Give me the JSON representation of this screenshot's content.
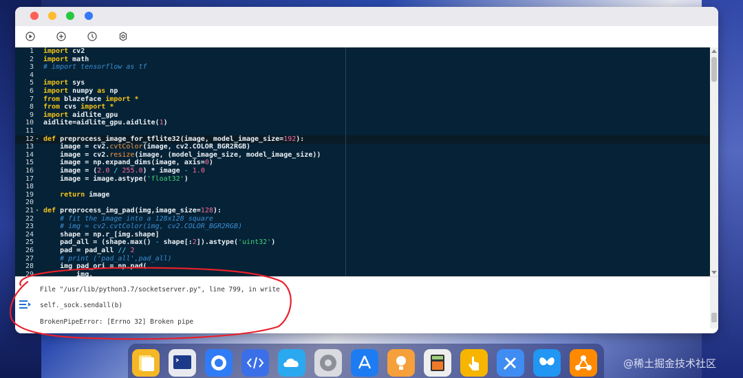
{
  "toolbar": {
    "buttons": [
      {
        "name": "run-button",
        "icon": "play-icon"
      },
      {
        "name": "add-button",
        "icon": "plus-icon"
      },
      {
        "name": "history-button",
        "icon": "clock-icon"
      },
      {
        "name": "settings-button",
        "icon": "gear-icon"
      }
    ]
  },
  "editor": {
    "lines": [
      {
        "n": "1",
        "fold": "",
        "segs": [
          [
            "k",
            "import"
          ],
          [
            "",
            "cv2"
          ]
        ]
      },
      {
        "n": "2",
        "fold": "",
        "segs": [
          [
            "k",
            "import"
          ],
          [
            "",
            "math"
          ]
        ]
      },
      {
        "n": "3",
        "fold": "",
        "segs": [
          [
            "c",
            "# import tensorflow as tf"
          ]
        ]
      },
      {
        "n": "4",
        "fold": "",
        "segs": []
      },
      {
        "n": "5",
        "fold": "",
        "segs": [
          [
            "k",
            "import"
          ],
          [
            "",
            "sys"
          ]
        ]
      },
      {
        "n": "6",
        "fold": "",
        "segs": [
          [
            "k",
            "import"
          ],
          [
            "",
            "numpy "
          ],
          [
            "k",
            "as"
          ],
          [
            "",
            "np"
          ]
        ]
      },
      {
        "n": "7",
        "fold": "",
        "segs": [
          [
            "k",
            "from"
          ],
          [
            "",
            "blazeface "
          ],
          [
            "k",
            "import"
          ],
          [
            "",
            ""
          ],
          [
            "k",
            "*"
          ]
        ]
      },
      {
        "n": "8",
        "fold": "",
        "segs": [
          [
            "k",
            "from"
          ],
          [
            "",
            "cvs "
          ],
          [
            "k",
            "import"
          ],
          [
            "",
            ""
          ],
          [
            "k",
            "*"
          ]
        ]
      },
      {
        "n": "9",
        "fold": "",
        "segs": [
          [
            "k",
            "import"
          ],
          [
            "",
            "aidlite_gpu"
          ]
        ]
      },
      {
        "n": "10",
        "fold": "",
        "segs": [
          [
            "",
            "aidlite=aidlite_gpu.aidlite("
          ],
          [
            "n",
            "1"
          ],
          [
            "",
            ")"
          ]
        ]
      },
      {
        "n": "11",
        "fold": "",
        "segs": []
      },
      {
        "n": "12",
        "fold": "▾",
        "segs": [
          [
            "k",
            "def"
          ],
          [
            "",
            "preprocess_image_for_tflite32(image, model_image_size="
          ],
          [
            "n",
            "192"
          ],
          [
            "",
            "):"
          ]
        ]
      },
      {
        "n": "13",
        "fold": "",
        "segs": [
          [
            "",
            "    image = cv2."
          ],
          [
            "f",
            "cvtColor"
          ],
          [
            "",
            "(image, cv2.COLOR_BGR2RGB)"
          ]
        ]
      },
      {
        "n": "14",
        "fold": "",
        "segs": [
          [
            "",
            "    image = cv2."
          ],
          [
            "f",
            "resize"
          ],
          [
            "",
            "(image, (model_image_size, model_image_size))"
          ]
        ]
      },
      {
        "n": "15",
        "fold": "",
        "segs": [
          [
            "",
            "    image = np.expand_dims(image, axis="
          ],
          [
            "n",
            "0"
          ],
          [
            "",
            ")"
          ]
        ]
      },
      {
        "n": "16",
        "fold": "",
        "segs": [
          [
            "",
            "    image = ("
          ],
          [
            "n",
            "2.0"
          ],
          [
            "b",
            " / "
          ],
          [
            "n",
            "255.0"
          ],
          [
            "",
            ") * image "
          ],
          [
            "b",
            "- "
          ],
          [
            "n",
            "1.0"
          ]
        ]
      },
      {
        "n": "17",
        "fold": "",
        "segs": [
          [
            "",
            "    image = image.astype("
          ],
          [
            "s",
            "'float32'"
          ],
          [
            "",
            ")"
          ]
        ]
      },
      {
        "n": "18",
        "fold": "",
        "segs": []
      },
      {
        "n": "19",
        "fold": "",
        "segs": [
          [
            "",
            "    "
          ],
          [
            "k",
            "return"
          ],
          [
            "",
            "image"
          ]
        ]
      },
      {
        "n": "20",
        "fold": "",
        "segs": []
      },
      {
        "n": "21",
        "fold": "▾",
        "segs": [
          [
            "k",
            "def"
          ],
          [
            "",
            "preprocess_img_pad(img,image_size="
          ],
          [
            "n",
            "128"
          ],
          [
            "",
            "):"
          ]
        ]
      },
      {
        "n": "22",
        "fold": "",
        "segs": [
          [
            "",
            "    "
          ],
          [
            "c",
            "# fit the image into a 128x128 square"
          ]
        ]
      },
      {
        "n": "23",
        "fold": "",
        "segs": [
          [
            "",
            "    "
          ],
          [
            "c",
            "# img = cv2.cvtColor(img, cv2.COLOR_BGR2RGB)"
          ]
        ]
      },
      {
        "n": "24",
        "fold": "",
        "segs": [
          [
            "",
            "    shape = np.r_[img.shape]"
          ]
        ]
      },
      {
        "n": "25",
        "fold": "",
        "segs": [
          [
            "",
            "    pad_all = (shape.max() "
          ],
          [
            "b",
            "- "
          ],
          [
            "",
            "shape[:"
          ],
          [
            "n",
            "2"
          ],
          [
            "",
            "]).astype("
          ],
          [
            "s",
            "'uint32'"
          ],
          [
            "",
            ")"
          ]
        ]
      },
      {
        "n": "26",
        "fold": "",
        "segs": [
          [
            "",
            "    pad = pad_all "
          ],
          [
            "b",
            "// "
          ],
          [
            "n",
            "2"
          ]
        ]
      },
      {
        "n": "27",
        "fold": "",
        "segs": [
          [
            "",
            "    "
          ],
          [
            "c",
            "# print ('pad_all',pad_all)"
          ]
        ]
      },
      {
        "n": "28",
        "fold": "",
        "segs": [
          [
            "",
            "    img_pad_ori = np.pad("
          ]
        ]
      },
      {
        "n": "29",
        "fold": "",
        "segs": [
          [
            "",
            "        img,"
          ]
        ]
      }
    ]
  },
  "console": {
    "line1": "File \"/usr/lib/python3.7/socketserver.py\", line 799, in write",
    "line2": "self._sock.sendall(b)",
    "line3": "BrokenPipeError: [Errno 32] Broken pipe"
  },
  "dock": {
    "apps": [
      "files-app-icon",
      "terminal-app-icon",
      "browser-app-icon",
      "code-app-icon",
      "cloud-app-icon",
      "settings-app-icon",
      "app-store-icon",
      "ideas-app-icon",
      "calculator-app-icon",
      "touch-app-icon",
      "tools-app-icon",
      "butterfly-app-icon",
      "network-app-icon"
    ]
  },
  "watermark": "@稀土掘金技术社区",
  "colors": {
    "editor_bg": "#052236",
    "keyword": "#f5c518",
    "comment": "#3d8fd6",
    "string": "#41d67a",
    "number": "#ff6b9f",
    "annotation": "#e8202a"
  }
}
